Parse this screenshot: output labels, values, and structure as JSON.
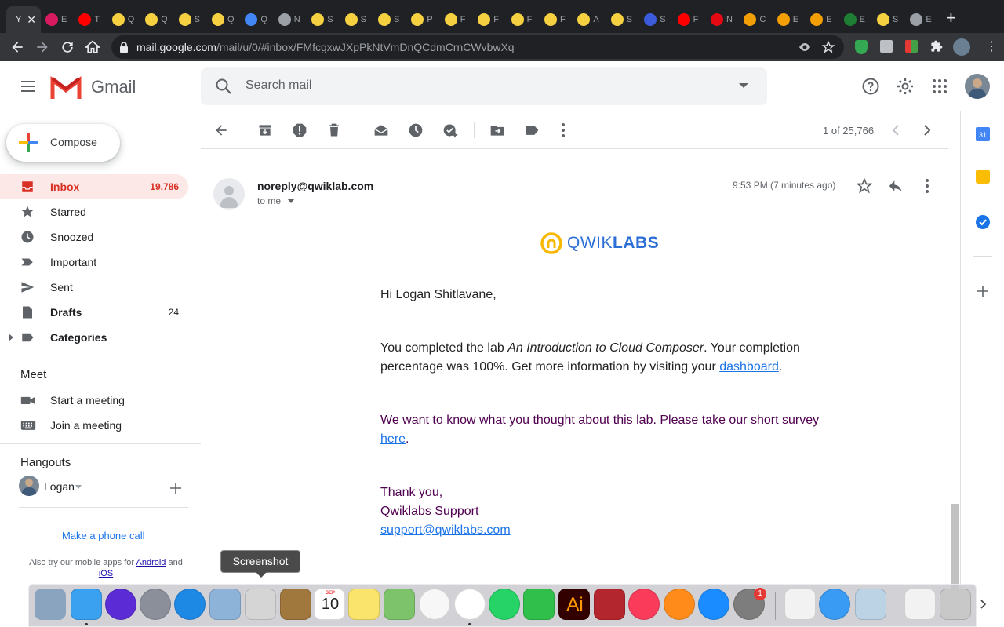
{
  "browser": {
    "tabs": [
      {
        "glyph": "Y",
        "favicon_color": "#e8eaed",
        "active": true
      },
      {
        "glyph": "E",
        "favicon_color": "#d81b60"
      },
      {
        "glyph": "T",
        "favicon_color": "#ff0000"
      },
      {
        "glyph": "Q",
        "favicon_color": "#f5d142"
      },
      {
        "glyph": "Q",
        "favicon_color": "#f5d142"
      },
      {
        "glyph": "S",
        "favicon_color": "#f5d142"
      },
      {
        "glyph": "Q",
        "favicon_color": "#f5d142"
      },
      {
        "glyph": "Q",
        "favicon_color": "#4285f4"
      },
      {
        "glyph": "N",
        "favicon_color": "#9aa0a6"
      },
      {
        "glyph": "S",
        "favicon_color": "#f5d142"
      },
      {
        "glyph": "S",
        "favicon_color": "#f5d142"
      },
      {
        "glyph": "S",
        "favicon_color": "#f5d142"
      },
      {
        "glyph": "P",
        "favicon_color": "#f5d142"
      },
      {
        "glyph": "F",
        "favicon_color": "#f5d142"
      },
      {
        "glyph": "F",
        "favicon_color": "#f5d142"
      },
      {
        "glyph": "F",
        "favicon_color": "#f5d142"
      },
      {
        "glyph": "F",
        "favicon_color": "#f5d142"
      },
      {
        "glyph": "A",
        "favicon_color": "#f5d142"
      },
      {
        "glyph": "S",
        "favicon_color": "#f5d142"
      },
      {
        "glyph": "S",
        "favicon_color": "#3b5bdb"
      },
      {
        "glyph": "F",
        "favicon_color": "#ff0000"
      },
      {
        "glyph": "N",
        "favicon_color": "#e50914"
      },
      {
        "glyph": "C",
        "favicon_color": "#f29f05"
      },
      {
        "glyph": "E",
        "favicon_color": "#f29f05"
      },
      {
        "glyph": "E",
        "favicon_color": "#f29f05"
      },
      {
        "glyph": "E",
        "favicon_color": "#1e7e34"
      },
      {
        "glyph": "S",
        "favicon_color": "#f5d142"
      },
      {
        "glyph": "E",
        "favicon_color": "#9aa0a6"
      }
    ],
    "url_host": "mail.google.com",
    "url_path": "/mail/u/0/#inbox/FMfcgxwJXpPkNtVmDnQCdmCrnCWvbwXq"
  },
  "gmail": {
    "logo_text": "Gmail",
    "search_placeholder": "Search mail",
    "compose_label": "Compose",
    "nav": [
      {
        "label": "Inbox",
        "count": "19,786",
        "icon": "inbox-icon",
        "active": true,
        "bold": true
      },
      {
        "label": "Starred",
        "count": "",
        "icon": "star-icon"
      },
      {
        "label": "Snoozed",
        "count": "",
        "icon": "clock-icon"
      },
      {
        "label": "Important",
        "count": "",
        "icon": "important-icon"
      },
      {
        "label": "Sent",
        "count": "",
        "icon": "send-icon"
      },
      {
        "label": "Drafts",
        "count": "24",
        "icon": "draft-icon",
        "bold": true
      },
      {
        "label": "Categories",
        "count": "",
        "icon": "label-icon",
        "bold": true
      }
    ],
    "meet": {
      "title": "Meet",
      "items": [
        {
          "label": "Start a meeting",
          "icon": "video-icon"
        },
        {
          "label": "Join a meeting",
          "icon": "keyboard-icon"
        }
      ]
    },
    "hangouts": {
      "title": "Hangouts",
      "user": "Logan",
      "phone_call": "Make a phone call",
      "mobile_prefix": "Also try our mobile apps for",
      "android": "Android",
      "and": "and",
      "ios": "iOS"
    },
    "pager": "1 of 25,766",
    "message": {
      "sender": "noreply@qwiklab.com",
      "to": "to me",
      "time": "9:53 PM (7 minutes ago)",
      "logo_light": "QWIK",
      "logo_bold": "LABS",
      "greeting": "Hi Logan Shitlavane,",
      "p1_before": "You completed the lab ",
      "p1_italic": "An Introduction to Cloud Composer",
      "p1_after": ". Your completion percentage was 100%. Get more information by visiting your ",
      "p1_link": "dashboard",
      "p1_end": ".",
      "p2_before": "We want to know what you thought about this lab. Please take our short survey ",
      "p2_link": "here",
      "p2_end": ".",
      "closing": "Thank you,",
      "signature": "Qwiklabs Support",
      "support_email": "support@qwiklabs.com"
    }
  },
  "tooltip": "Screenshot",
  "dock": {
    "calendar_month": "SEP",
    "calendar_day": "10",
    "illustrator_label": "Ai",
    "preferences_badge": "1",
    "apps": [
      {
        "name": "finder-icon",
        "color": "#3aa0f0"
      },
      {
        "name": "siri-icon",
        "color": "#5b2bd6"
      },
      {
        "name": "launchpad-icon",
        "color": "#8a8f99"
      },
      {
        "name": "safari-icon",
        "color": "#1e88e5"
      },
      {
        "name": "mail-stamp-icon",
        "color": "#8db3d9"
      },
      {
        "name": "screenshot-icon",
        "color": "#d5d5d5"
      },
      {
        "name": "contacts-icon",
        "color": "#a0773c"
      },
      {
        "name": "calendar-icon",
        "color": "#ffffff"
      },
      {
        "name": "notes-icon",
        "color": "#fbe46b"
      },
      {
        "name": "maps-icon",
        "color": "#7cc36b"
      },
      {
        "name": "photos-icon",
        "color": "#f7f7f7"
      },
      {
        "name": "chrome-icon",
        "color": "#ffffff"
      },
      {
        "name": "whatsapp-icon",
        "color": "#25d366"
      },
      {
        "name": "facetime-icon",
        "color": "#2fbf4a"
      },
      {
        "name": "illustrator-icon",
        "color": "#330000"
      },
      {
        "name": "photo-booth-icon",
        "color": "#b3262d"
      },
      {
        "name": "music-icon",
        "color": "#fa3b5a"
      },
      {
        "name": "books-icon",
        "color": "#ff8c1a"
      },
      {
        "name": "app-store-icon",
        "color": "#1a8cff"
      },
      {
        "name": "system-preferences-icon",
        "color": "#7d7d7d"
      },
      {
        "name": "textedit-icon",
        "color": "#f2f2f2"
      },
      {
        "name": "messages-icon",
        "color": "#3a9bf4"
      },
      {
        "name": "preview-icon",
        "color": "#bcd3e6"
      },
      {
        "name": "document-icon",
        "color": "#f2f2f2"
      },
      {
        "name": "trash-icon",
        "color": "#c8c8c8"
      }
    ]
  }
}
